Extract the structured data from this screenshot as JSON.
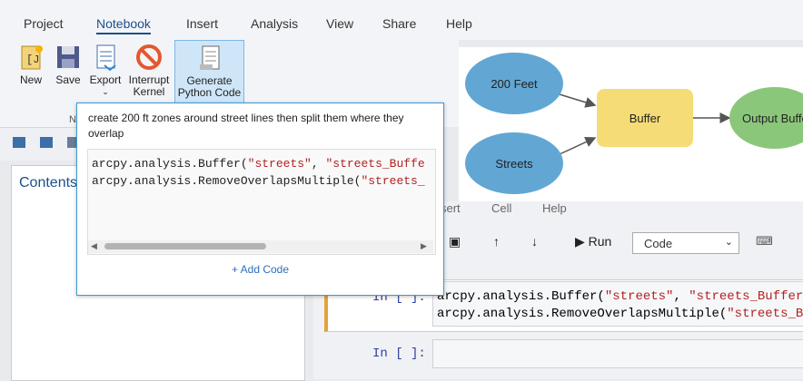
{
  "menu": [
    "Project",
    "Notebook",
    "Insert",
    "Analysis",
    "View",
    "Share",
    "Help"
  ],
  "ribbon": {
    "new": "New",
    "save": "Save",
    "export": "Export",
    "interrupt1": "Interrupt",
    "interrupt2": "Kernel",
    "generate1": "Generate",
    "generate2": "Python Code",
    "group_letter": "N"
  },
  "contents": {
    "title": "Contents"
  },
  "diagram": {
    "input1": "200 Feet",
    "input2": "Streets",
    "tool": "Buffer",
    "output": "Output Buffe"
  },
  "notebook": {
    "menu": [
      "sert",
      "Cell",
      "Help"
    ],
    "run_label": "Run",
    "cell_type": "Code",
    "prompt": "In [ ]:",
    "cell1": {
      "line1_a": "arcpy.analysis.Buffer(",
      "line1_b": "\"streets\"",
      "line1_c": ", ",
      "line1_d": "\"streets_Buffers\"",
      "line2_a": "arcpy.analysis.RemoveOverlapsMultiple(",
      "line2_b": "\"streets_Buf"
    }
  },
  "popup": {
    "prompt_text": "create 200 ft zones around street lines then split them where they overlap",
    "code1_a": "arcpy.analysis.Buffer(",
    "code1_b": "\"streets\"",
    "code1_c": ", ",
    "code1_d": "\"streets_Buffe",
    "code2_a": "arcpy.analysis.RemoveOverlapsMultiple(",
    "code2_b": "\"streets_",
    "add_code": "+ Add Code"
  },
  "colors": {
    "accent": "#1d4f8a",
    "popup_border": "#3c9ad6",
    "node_blue": "#62a6d4",
    "node_yellow": "#f6dc76",
    "node_green": "#8bc77a"
  }
}
